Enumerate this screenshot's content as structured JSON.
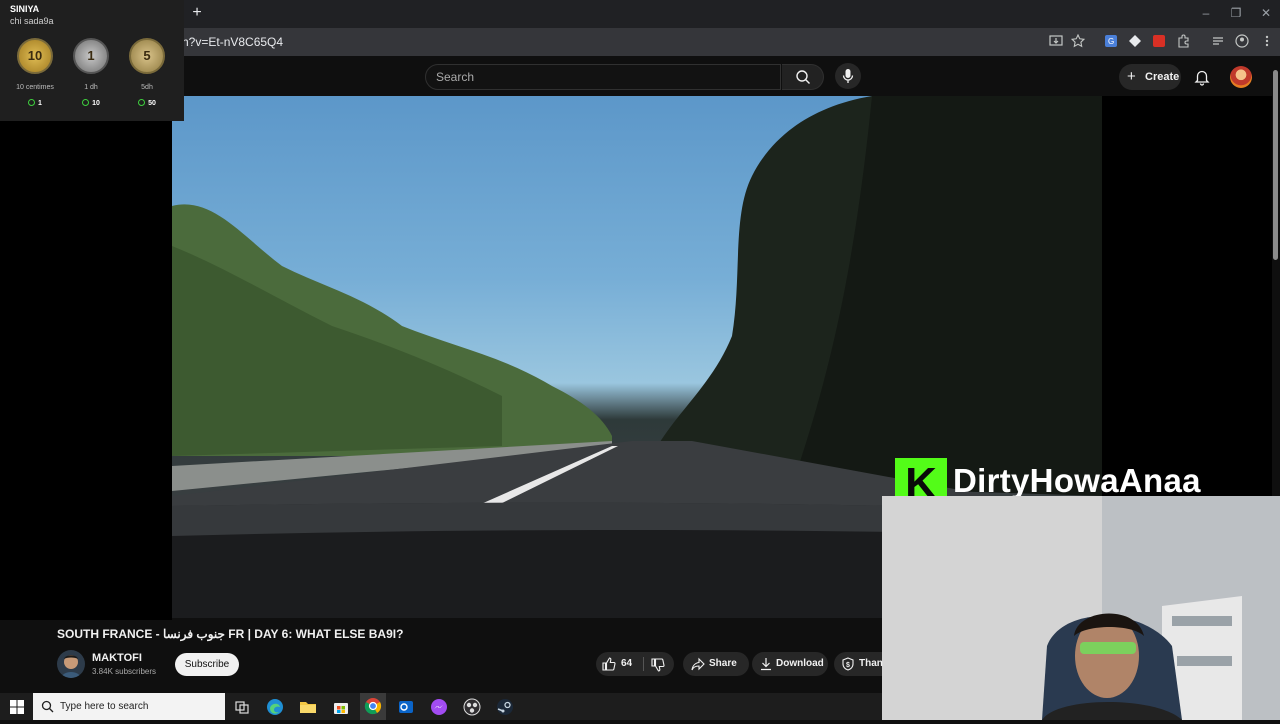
{
  "browser": {
    "url_fragment": "h?v=Et-nV8C65Q4",
    "new_tab_label": "+",
    "window_controls": [
      "–",
      "❐",
      "✕"
    ]
  },
  "header": {
    "search_placeholder": "Search",
    "create_label": "Create"
  },
  "overlay_widget": {
    "title": "SINIYA",
    "subtitle": "chi sada9a",
    "coins": [
      {
        "face": "10",
        "label": "10 centimes",
        "count": "1",
        "color": "#c9a23a"
      },
      {
        "face": "1",
        "label": "1 dh",
        "count": "10",
        "color": "#9e9e9e"
      },
      {
        "face": "5",
        "label": "5dh",
        "count": "50",
        "color": "#b8a06a"
      }
    ]
  },
  "streamer": {
    "name": "DirtyHowaAnaa",
    "logo_letter": "K",
    "brand_color": "#53fc18"
  },
  "video": {
    "title": "SOUTH FRANCE - جنوب فرنسا FR | DAY 6: WHAT ELSE BA9I?",
    "channel_name": "MAKTOFI",
    "subscribers": "3.84K subscribers",
    "subscribe_label": "Subscribe",
    "like_count": "64",
    "share_label": "Share",
    "download_label": "Download",
    "thanks_label": "Than"
  },
  "taskbar": {
    "search_placeholder": "Type here to search"
  }
}
